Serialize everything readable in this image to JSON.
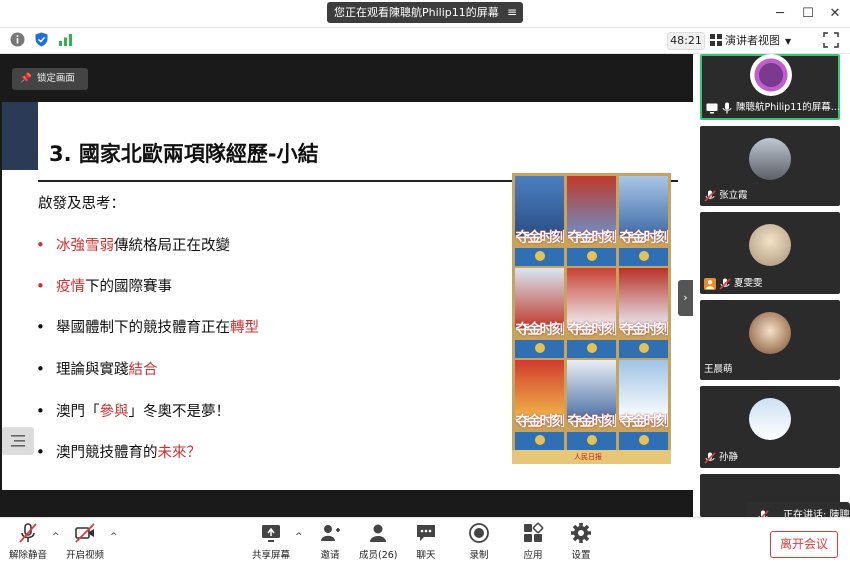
{
  "window": {
    "share_banner": "您正在观看陳聰航Philip11的屏幕"
  },
  "infobar": {
    "timer": "48:21",
    "view_mode": "演讲者视图"
  },
  "stage": {
    "lock_label": "锁定画面",
    "slide": {
      "title": "3. 國家北歐兩項隊經歷-小結",
      "subtitle": "啟發及思考：",
      "bullets": [
        {
          "pre": "",
          "red": "冰強雪弱",
          "post": "傳統格局正在改變"
        },
        {
          "pre": "",
          "red": "疫情",
          "post": "下的國際賽事"
        },
        {
          "pre": "舉國體制下的競技體育正在",
          "red": "轉型",
          "post": ""
        },
        {
          "pre": "理論與實踐",
          "red": "結合",
          "post": ""
        },
        {
          "pre": "澳門「",
          "red": "參與",
          "post": "」冬奧不是夢！"
        },
        {
          "pre": "澳門競技體育的",
          "red": "未來？",
          "post": ""
        }
      ],
      "poster_caption": "夺金时刻",
      "poster_footer": "人民日报"
    }
  },
  "participants": [
    {
      "name": "陳聰航Philip11的屏幕..."
    },
    {
      "name": "张立霞"
    },
    {
      "name": "夏雯雯"
    },
    {
      "name": "王晨萌"
    },
    {
      "name": "孙静"
    }
  ],
  "speaking": "正在讲话: 陳聰航",
  "toolbar": {
    "unmute": "解除静音",
    "start_video": "开启视频",
    "share_screen": "共享屏幕",
    "invite": "邀请",
    "members": "成员(26)",
    "chat": "聊天",
    "record": "录制",
    "apps": "应用",
    "settings": "设置",
    "leave": "离开会议"
  },
  "colors": {
    "accent_red": "#d32f2f",
    "active_green": "#2ecc71",
    "leave_red": "#e03a3a"
  }
}
